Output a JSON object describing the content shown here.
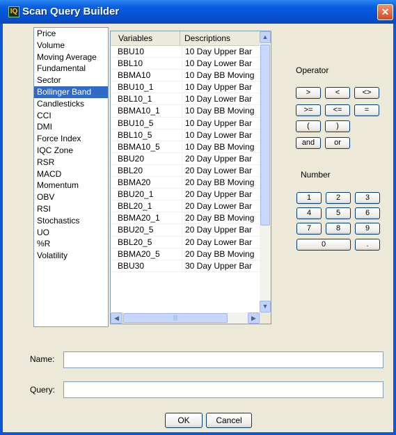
{
  "window": {
    "title": "Scan Query Builder",
    "close_label": "✕",
    "app_icon": "IQ"
  },
  "categories": [
    {
      "label": "Price"
    },
    {
      "label": "Volume"
    },
    {
      "label": "Moving Average"
    },
    {
      "label": "Fundamental"
    },
    {
      "label": "Sector"
    },
    {
      "label": "Bollinger Band",
      "selected": true
    },
    {
      "label": "Candlesticks"
    },
    {
      "label": "CCI"
    },
    {
      "label": "DMI"
    },
    {
      "label": "Force Index"
    },
    {
      "label": "IQC Zone"
    },
    {
      "label": "RSR"
    },
    {
      "label": "MACD"
    },
    {
      "label": "Momentum"
    },
    {
      "label": "OBV"
    },
    {
      "label": "RSI"
    },
    {
      "label": "Stochastics"
    },
    {
      "label": "UO"
    },
    {
      "label": "%R"
    },
    {
      "label": "Volatility"
    }
  ],
  "grid": {
    "headers": [
      "Variables",
      "Descriptions"
    ],
    "rows": [
      [
        "BBU10",
        "10 Day Upper Bar"
      ],
      [
        "BBL10",
        "10 Day Lower Bar"
      ],
      [
        "BBMA10",
        "10 Day BB Moving"
      ],
      [
        "BBU10_1",
        "10 Day Upper Bar"
      ],
      [
        "BBL10_1",
        "10 Day Lower Bar"
      ],
      [
        "BBMA10_1",
        "10 Day BB Moving"
      ],
      [
        "BBU10_5",
        "10 Day Upper Bar"
      ],
      [
        "BBL10_5",
        "10 Day Lower Bar"
      ],
      [
        "BBMA10_5",
        "10 Day BB Moving"
      ],
      [
        "BBU20",
        "20 Day Upper Bar"
      ],
      [
        "BBL20",
        "20 Day Lower Bar"
      ],
      [
        "BBMA20",
        "20 Day BB Moving"
      ],
      [
        "BBU20_1",
        "20 Day Upper Bar"
      ],
      [
        "BBL20_1",
        "20 Day Lower Bar"
      ],
      [
        "BBMA20_1",
        "20 Day BB Moving"
      ],
      [
        "BBU20_5",
        "20 Day Upper Bar"
      ],
      [
        "BBL20_5",
        "20 Day Lower Bar"
      ],
      [
        "BBMA20_5",
        "20 Day BB Moving"
      ],
      [
        "BBU30",
        "30 Day Upper Bar"
      ]
    ],
    "scroll_up": "▲",
    "scroll_down": "▼",
    "scroll_left": "◀",
    "scroll_right": "▶",
    "thumb_grip": "|||"
  },
  "operator": {
    "label": "Operator",
    "buttons": [
      ">",
      "<",
      "<>",
      ">=",
      "<=",
      "=",
      "(",
      ")",
      "and",
      "or"
    ]
  },
  "number": {
    "label": "Number",
    "buttons": [
      "1",
      "2",
      "3",
      "4",
      "5",
      "6",
      "7",
      "8",
      "9",
      "0",
      "."
    ]
  },
  "form": {
    "name_label": "Name:",
    "name_value": "",
    "query_label": "Query:",
    "query_value": ""
  },
  "actions": {
    "ok_label": "OK",
    "cancel_label": "Cancel"
  }
}
